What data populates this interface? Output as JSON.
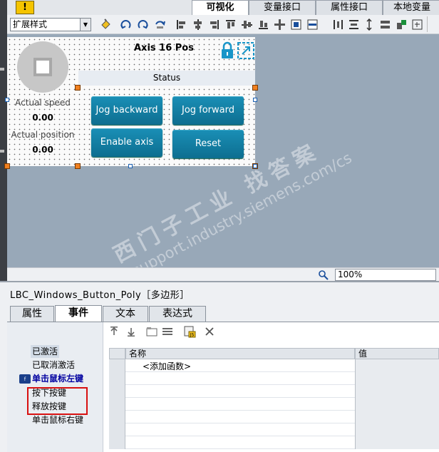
{
  "top_tabs": [
    {
      "label": "可视化",
      "active": true
    },
    {
      "label": "变量接口",
      "active": false
    },
    {
      "label": "属性接口",
      "active": false
    },
    {
      "label": "本地变量",
      "active": false
    }
  ],
  "toolbar": {
    "style_select_value": "扩展样式",
    "icons": [
      "paint-bucket-icon",
      "rotate-left-icon",
      "rotate-right-icon",
      "rotate-icon",
      "align-left-icon",
      "align-center-icon",
      "align-right-icon",
      "align-top-icon",
      "align-middle-icon",
      "align-bottom-icon",
      "center-icon",
      "front-icon",
      "back-icon",
      "distribute-horizontal-icon",
      "distribute-vertical-icon",
      "same-height-icon",
      "same-width-icon",
      "group-icon",
      "fit-icon"
    ]
  },
  "faceplate": {
    "title": "Axis 16 Pos",
    "status_label": "Status",
    "actual_speed_label": "Actual speed",
    "actual_speed_value": "0.00",
    "actual_position_label": "Actual position",
    "actual_position_value": "0.00",
    "buttons": {
      "jog_backward": "Jog backward",
      "jog_forward": "Jog forward",
      "enable_axis": "Enable axis",
      "reset": "Reset"
    }
  },
  "watermark": {
    "line1": "西门子工业  找答案",
    "line2": "support.industry.siemens.com/cs"
  },
  "zoom": {
    "value": "100%"
  },
  "inspector": {
    "title": "LBC_Windows_Button_Poly［多边形］",
    "tabs": [
      {
        "label": "属性",
        "active": false
      },
      {
        "label": "事件",
        "active": true
      },
      {
        "label": "文本",
        "active": false
      },
      {
        "label": "表达式",
        "active": false
      }
    ],
    "events": [
      {
        "label": "已激活",
        "selected": true,
        "bold": false
      },
      {
        "label": "已取消激活",
        "selected": false,
        "bold": false
      },
      {
        "label": "单击鼠标左键",
        "selected": false,
        "bold": true
      },
      {
        "label": "按下按键",
        "selected": false,
        "bold": false
      },
      {
        "label": "释放按键",
        "selected": false,
        "bold": false
      },
      {
        "label": "单击鼠标右键",
        "selected": false,
        "bold": false
      }
    ],
    "grid": {
      "col_name": "名称",
      "col_value": "值",
      "add_function": "<添加函数>"
    },
    "colors": {
      "highlight_box": "#d81010",
      "button_blue": "#0d7ea4"
    }
  }
}
